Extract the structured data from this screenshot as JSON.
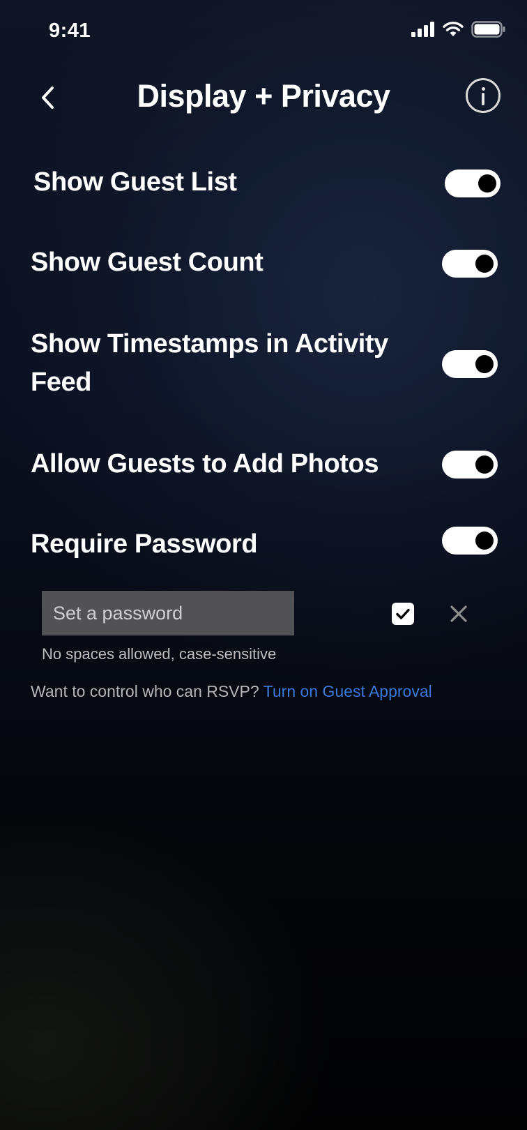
{
  "status_bar": {
    "time": "9:41"
  },
  "header": {
    "title": "Display + Privacy",
    "back_icon": "chevron-left-icon",
    "info_icon": "info-icon"
  },
  "settings": [
    {
      "label": "Show Guest List",
      "enabled": true
    },
    {
      "label": "Show Guest Count",
      "enabled": true
    },
    {
      "label": "Show Timestamps in Activity Feed",
      "enabled": true
    },
    {
      "label": "Allow Guests to Add Photos",
      "enabled": true
    },
    {
      "label": "Require Password",
      "enabled": true
    }
  ],
  "password": {
    "placeholder": "Set a password",
    "value": "",
    "hint": "No spaces allowed, case-sensitive",
    "confirm_icon": "checkmark-icon",
    "cancel_icon": "close-icon"
  },
  "approval": {
    "prompt": "Want to control who can RSVP? ",
    "link": "Turn on Guest Approval"
  },
  "colors": {
    "link": "#3a78d8",
    "toggle_on": "#ffffff",
    "input_bg": "#525256"
  }
}
